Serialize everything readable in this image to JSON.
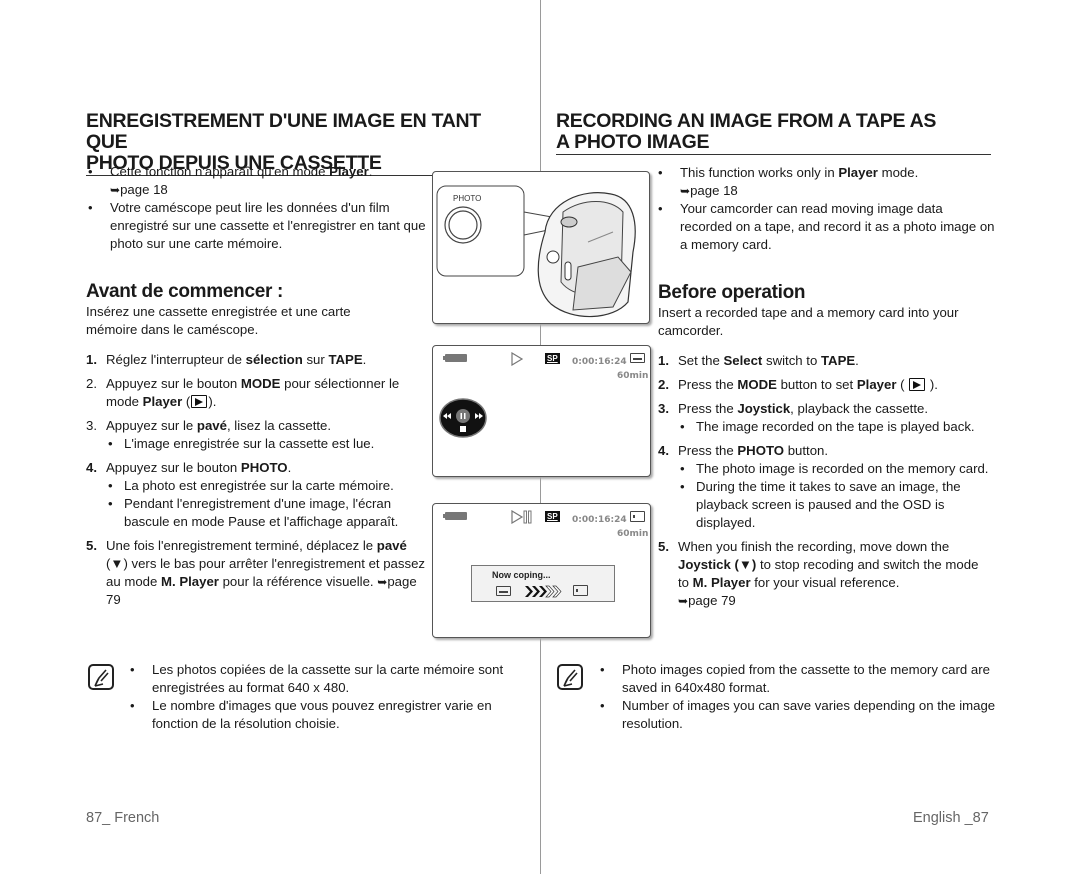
{
  "left": {
    "title_line1": "ENREGISTREMENT D'UNE IMAGE EN TANT QUE",
    "title_line2": "PHOTO DEPUIS UNE CASSETTE",
    "intro": [
      {
        "pre": "Cette fonction n'apparaît qu'en mode ",
        "bold": "Player",
        "post": ".",
        "ref": "page 18"
      },
      {
        "text": "Votre caméscope peut lire les données d'un film enregistré sur une cassette et l'enregistrer en tant que photo sur une carte mémoire."
      }
    ],
    "before_heading": "Avant de commencer :",
    "before_text": "Insérez une cassette enregistrée et une carte mémoire dans le caméscope.",
    "steps": [
      {
        "num": "1.",
        "a": "Réglez l'interrupteur de ",
        "b": "sélection",
        "c": " sur ",
        "d": "TAPE",
        "e": "."
      },
      {
        "num": "2.",
        "a": "Appuyez sur le bouton ",
        "b": "MODE",
        "c": " pour sélectionner le mode ",
        "d": "Player",
        "e": " (",
        "f": ")."
      },
      {
        "num": "3.",
        "a": "Appuyez sur le ",
        "b": "pavé",
        "c": ", lisez la cassette.",
        "sub": [
          "L'image enregistrée sur la cassette est lue."
        ]
      },
      {
        "num": "4.",
        "a": "Appuyez sur le bouton ",
        "b": "PHOTO",
        "c": ".",
        "sub": [
          "La photo est enregistrée sur la carte mémoire.",
          "Pendant l'enregistrement d'une image, l'écran bascule en mode Pause et l'affichage apparaît."
        ]
      },
      {
        "num": "5.",
        "a": "Une fois l'enregistrement terminé, déplacez le ",
        "b": "pavé",
        "c": " (▼) vers le bas pour arrêter l'enregistrement et passez au mode ",
        "d": "M. Player",
        "e": " pour la référence visuelle. ",
        "ref": "page 79"
      }
    ],
    "notes": [
      "Les photos copiées de la cassette sur la carte mémoire sont enregistrées au format 640 x 480.",
      "Le nombre d'images que vous pouvez enregistrer varie en fonction de la résolution choisie."
    ],
    "footer": "87_ French"
  },
  "right": {
    "title_line1": "RECORDING AN IMAGE FROM A TAPE AS",
    "title_line2": "A PHOTO IMAGE",
    "intro": [
      {
        "pre": "This function works only in ",
        "bold": "Player",
        "post": " mode.",
        "ref": "page 18"
      },
      {
        "text": "Your camcorder can read moving image data recorded on a tape, and record it as a photo image on a memory card."
      }
    ],
    "before_heading": "Before operation",
    "before_text": "Insert a recorded tape and a memory card into your camcorder.",
    "steps": [
      {
        "num": "1.",
        "a": "Set the ",
        "b": "Select",
        "c": " switch to ",
        "d": "TAPE",
        "e": "."
      },
      {
        "num": "2.",
        "a": "Press the ",
        "b": "MODE",
        "c": " button to set ",
        "d": "Player",
        "e": " ( ",
        "f": " )."
      },
      {
        "num": "3.",
        "a": "Press the ",
        "b": "Joystick",
        "c": ", playback the cassette.",
        "sub": [
          "The image recorded on the tape is played back."
        ]
      },
      {
        "num": "4.",
        "a": "Press the ",
        "b": "PHOTO",
        "c": " button.",
        "sub": [
          "The photo image is recorded on the memory card.",
          "During the time it takes to save an image, the playback screen is paused and the OSD is displayed."
        ]
      },
      {
        "num": "5.",
        "a": "When you finish the recording, move down the ",
        "b": "Joystick (▼)",
        "c": " to stop recoding and switch the mode to ",
        "d": "M. Player",
        "e": " for your visual reference.",
        "ref": "page 79"
      }
    ],
    "notes": [
      "Photo images copied from the cassette to the memory card are saved in 640x480 format.",
      "Number of images you can save varies depending on the image resolution."
    ],
    "footer": "English _87"
  },
  "figures": {
    "camera": {
      "button_label": "PHOTO"
    },
    "lcd1": {
      "mode": "SP",
      "timecode": "0:00:16:24",
      "remaining": "60min",
      "state": "play"
    },
    "lcd2": {
      "mode": "SP",
      "timecode": "0:00:16:24",
      "remaining": "60min",
      "state": "pause",
      "copy_message": "Now coping..."
    }
  },
  "ref_arrow": "➥"
}
